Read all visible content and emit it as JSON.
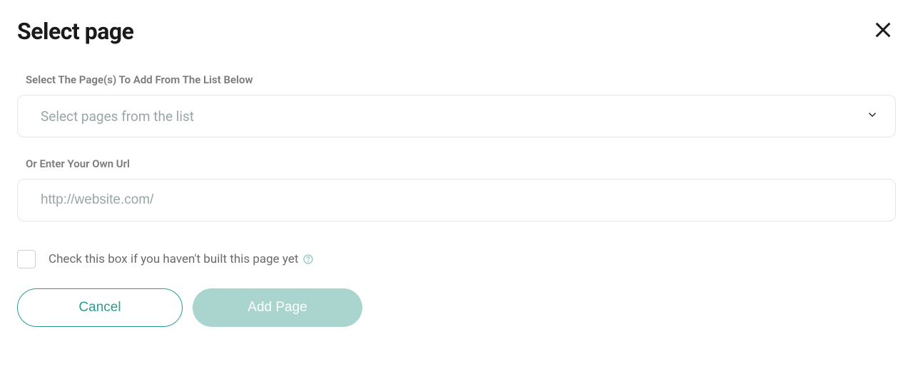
{
  "modal": {
    "title": "Select page",
    "close_aria": "Close"
  },
  "page_select": {
    "label": "Select The Page(s) To Add From The List Below",
    "placeholder": "Select pages from the list"
  },
  "url_field": {
    "label": "Or Enter Your Own Url",
    "placeholder": "http://website.com/",
    "value": ""
  },
  "checkbox": {
    "label": "Check this box if you haven't built this page yet",
    "checked": false
  },
  "buttons": {
    "cancel": "Cancel",
    "add_page": "Add Page"
  }
}
